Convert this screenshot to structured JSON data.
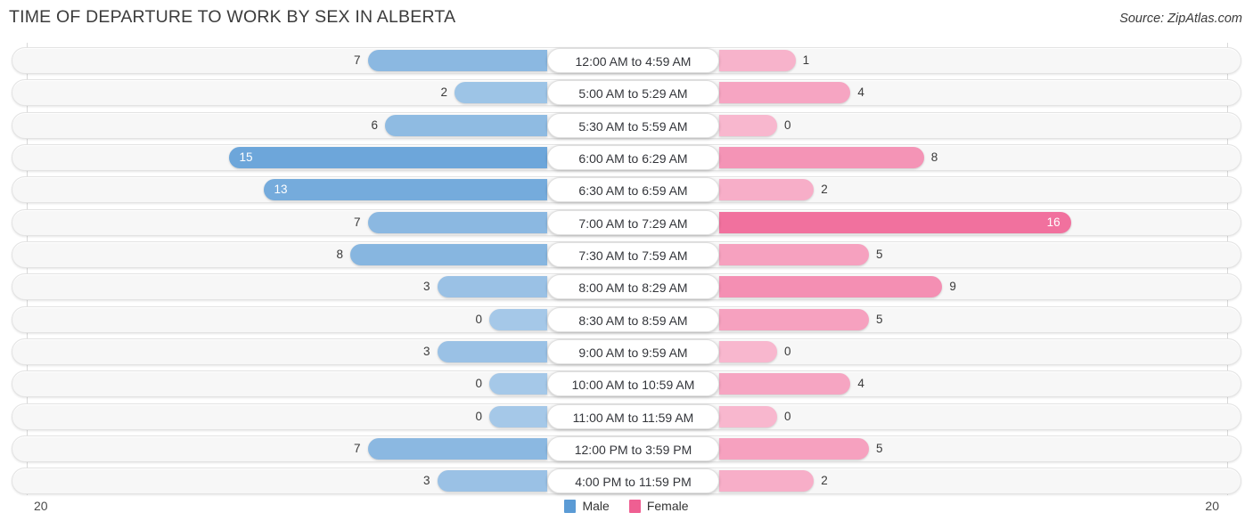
{
  "header": {
    "title": "TIME OF DEPARTURE TO WORK BY SEX IN ALBERTA",
    "source": "Source: ZipAtlas.com"
  },
  "footer": {
    "axis_max_left": "20",
    "axis_max_right": "20"
  },
  "legend": [
    {
      "label": "Male",
      "color": "#5b9bd5"
    },
    {
      "label": "Female",
      "color": "#ef5f92"
    }
  ],
  "colors": {
    "male_base": "#5b9bd5",
    "female_base": "#ef5f92",
    "track_fill": "#f7f7f7",
    "track_border": "#e3e3e3",
    "axis_line": "#d9d9d9",
    "title_text": "#3c3c3c"
  },
  "chart_data": {
    "type": "bar",
    "subtype": "diverging-bidirectional-bar",
    "title": "TIME OF DEPARTURE TO WORK BY SEX IN ALBERTA",
    "xlabel": "",
    "ylabel": "",
    "xlim_left": [
      0,
      20
    ],
    "xlim_right": [
      0,
      20
    ],
    "grid": false,
    "legend_position": "bottom-center",
    "categories": [
      "12:00 AM to 4:59 AM",
      "5:00 AM to 5:29 AM",
      "5:30 AM to 5:59 AM",
      "6:00 AM to 6:29 AM",
      "6:30 AM to 6:59 AM",
      "7:00 AM to 7:29 AM",
      "7:30 AM to 7:59 AM",
      "8:00 AM to 8:29 AM",
      "8:30 AM to 8:59 AM",
      "9:00 AM to 9:59 AM",
      "10:00 AM to 10:59 AM",
      "11:00 AM to 11:59 AM",
      "12:00 PM to 3:59 PM",
      "4:00 PM to 11:59 PM"
    ],
    "series": [
      {
        "name": "Male",
        "direction": "left",
        "values": [
          7,
          2,
          6,
          15,
          13,
          7,
          8,
          3,
          0,
          3,
          0,
          0,
          7,
          3
        ]
      },
      {
        "name": "Female",
        "direction": "right",
        "values": [
          1,
          4,
          0,
          8,
          2,
          16,
          5,
          9,
          5,
          0,
          4,
          0,
          5,
          2
        ]
      }
    ]
  }
}
